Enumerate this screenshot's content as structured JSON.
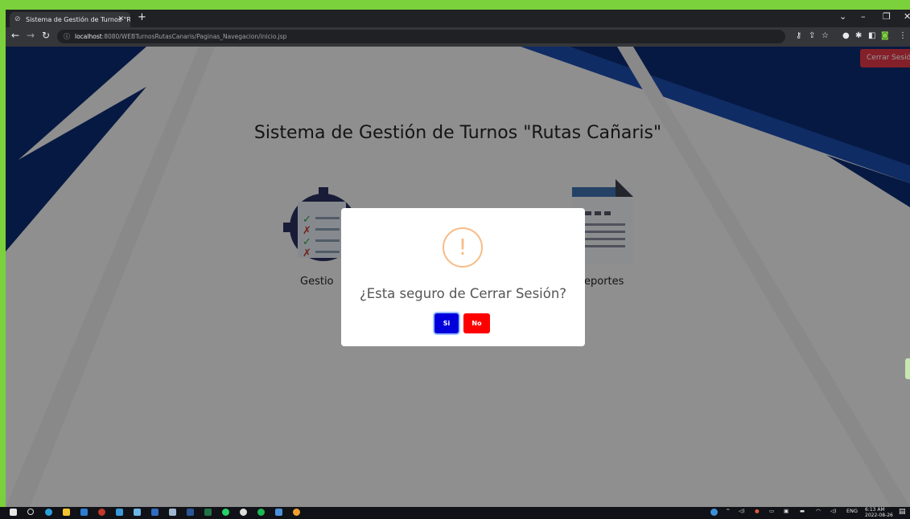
{
  "browser": {
    "tab_title": "Sistema de Gestión de Turnos \"R",
    "url_host": "localhost",
    "url_rest": ":8080/WEBTurnosRutasCanaris/Paginas_Navegacion/inicio.jsp"
  },
  "page": {
    "logout_label": "Cerrar Sesión",
    "title": "Sistema de Gestión de Turnos \"Rutas Cañaris\"",
    "card_left_label": "Gestio",
    "card_right_label": "eportes"
  },
  "dialog": {
    "icon_glyph": "!",
    "question": "¿Esta seguro de Cerrar Sesión?",
    "yes_label": "Si",
    "no_label": "No"
  },
  "taskbar": {
    "lang": "ENG",
    "time": "6:13 AM",
    "date": "2022-08-26"
  },
  "colors": {
    "navy": "#0a2a6e",
    "yes": "#0000dd",
    "no": "#ff0000",
    "warning": "#f8bb86",
    "logout": "#dc3545"
  }
}
